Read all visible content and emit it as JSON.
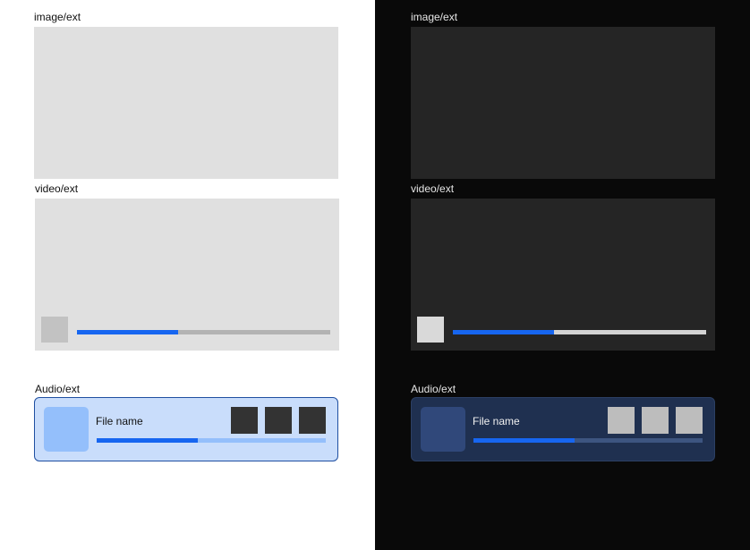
{
  "colors": {
    "accent": "#1766f0",
    "light_background": "#ffffff",
    "dark_background": "#090909"
  },
  "light": {
    "image_label": "image/ext",
    "video_label": "video/ext",
    "video_progress": 0.4,
    "audio_label": "Audio/ext",
    "audio": {
      "file_name": "File name",
      "progress": 0.44
    }
  },
  "dark": {
    "image_label": "image/ext",
    "video_label": "video/ext",
    "video_progress": 0.4,
    "audio_label": "Audio/ext",
    "audio": {
      "file_name": "File name",
      "progress": 0.44
    }
  }
}
